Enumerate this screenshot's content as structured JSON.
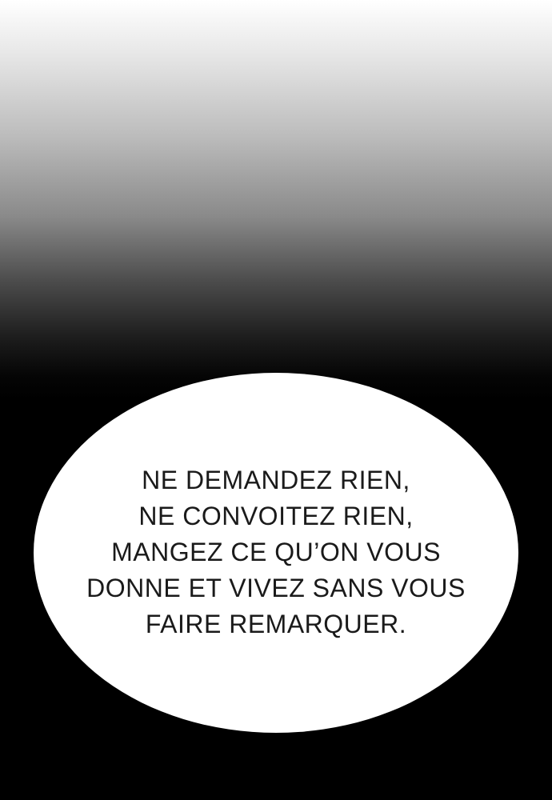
{
  "speech_bubble": {
    "lines": [
      "NE DEMANDEZ RIEN,",
      "NE CONVOITEZ RIEN,",
      "MANGEZ CE QU’ON VOUS",
      "DONNE ET VIVEZ SANS VOUS",
      "FAIRE REMARQUER."
    ]
  },
  "colors": {
    "bubble_fill": "#ffffff",
    "text": "#1a1a1a",
    "background_top": "#ffffff",
    "background_bottom": "#000000"
  }
}
